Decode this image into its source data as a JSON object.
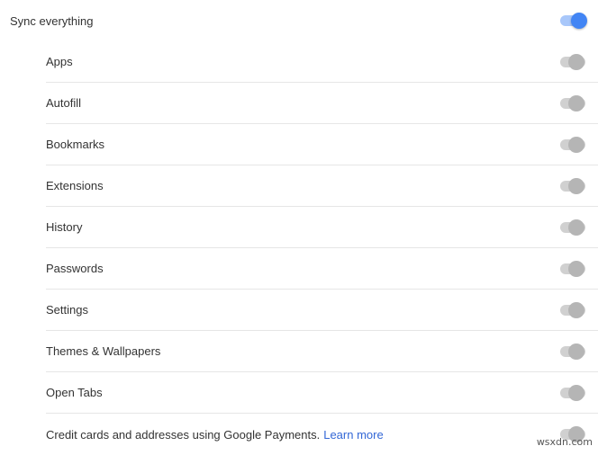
{
  "master": {
    "label": "Sync everything",
    "enabled": true
  },
  "items": [
    {
      "label": "Apps",
      "enabled": true
    },
    {
      "label": "Autofill",
      "enabled": true
    },
    {
      "label": "Bookmarks",
      "enabled": true
    },
    {
      "label": "Extensions",
      "enabled": true
    },
    {
      "label": "History",
      "enabled": true
    },
    {
      "label": "Passwords",
      "enabled": true
    },
    {
      "label": "Settings",
      "enabled": true
    },
    {
      "label": "Themes & Wallpapers",
      "enabled": true
    },
    {
      "label": "Open Tabs",
      "enabled": true
    },
    {
      "label": "Credit cards and addresses using Google Payments.",
      "enabled": true,
      "link": "Learn more"
    }
  ],
  "watermark": "wsxdn.com",
  "colors": {
    "accent": "#4285f4",
    "accent_track": "#a8c7fa",
    "disabled_knob": "#b5b5b5",
    "disabled_track": "#d0d0d0",
    "link": "#3367d6"
  }
}
